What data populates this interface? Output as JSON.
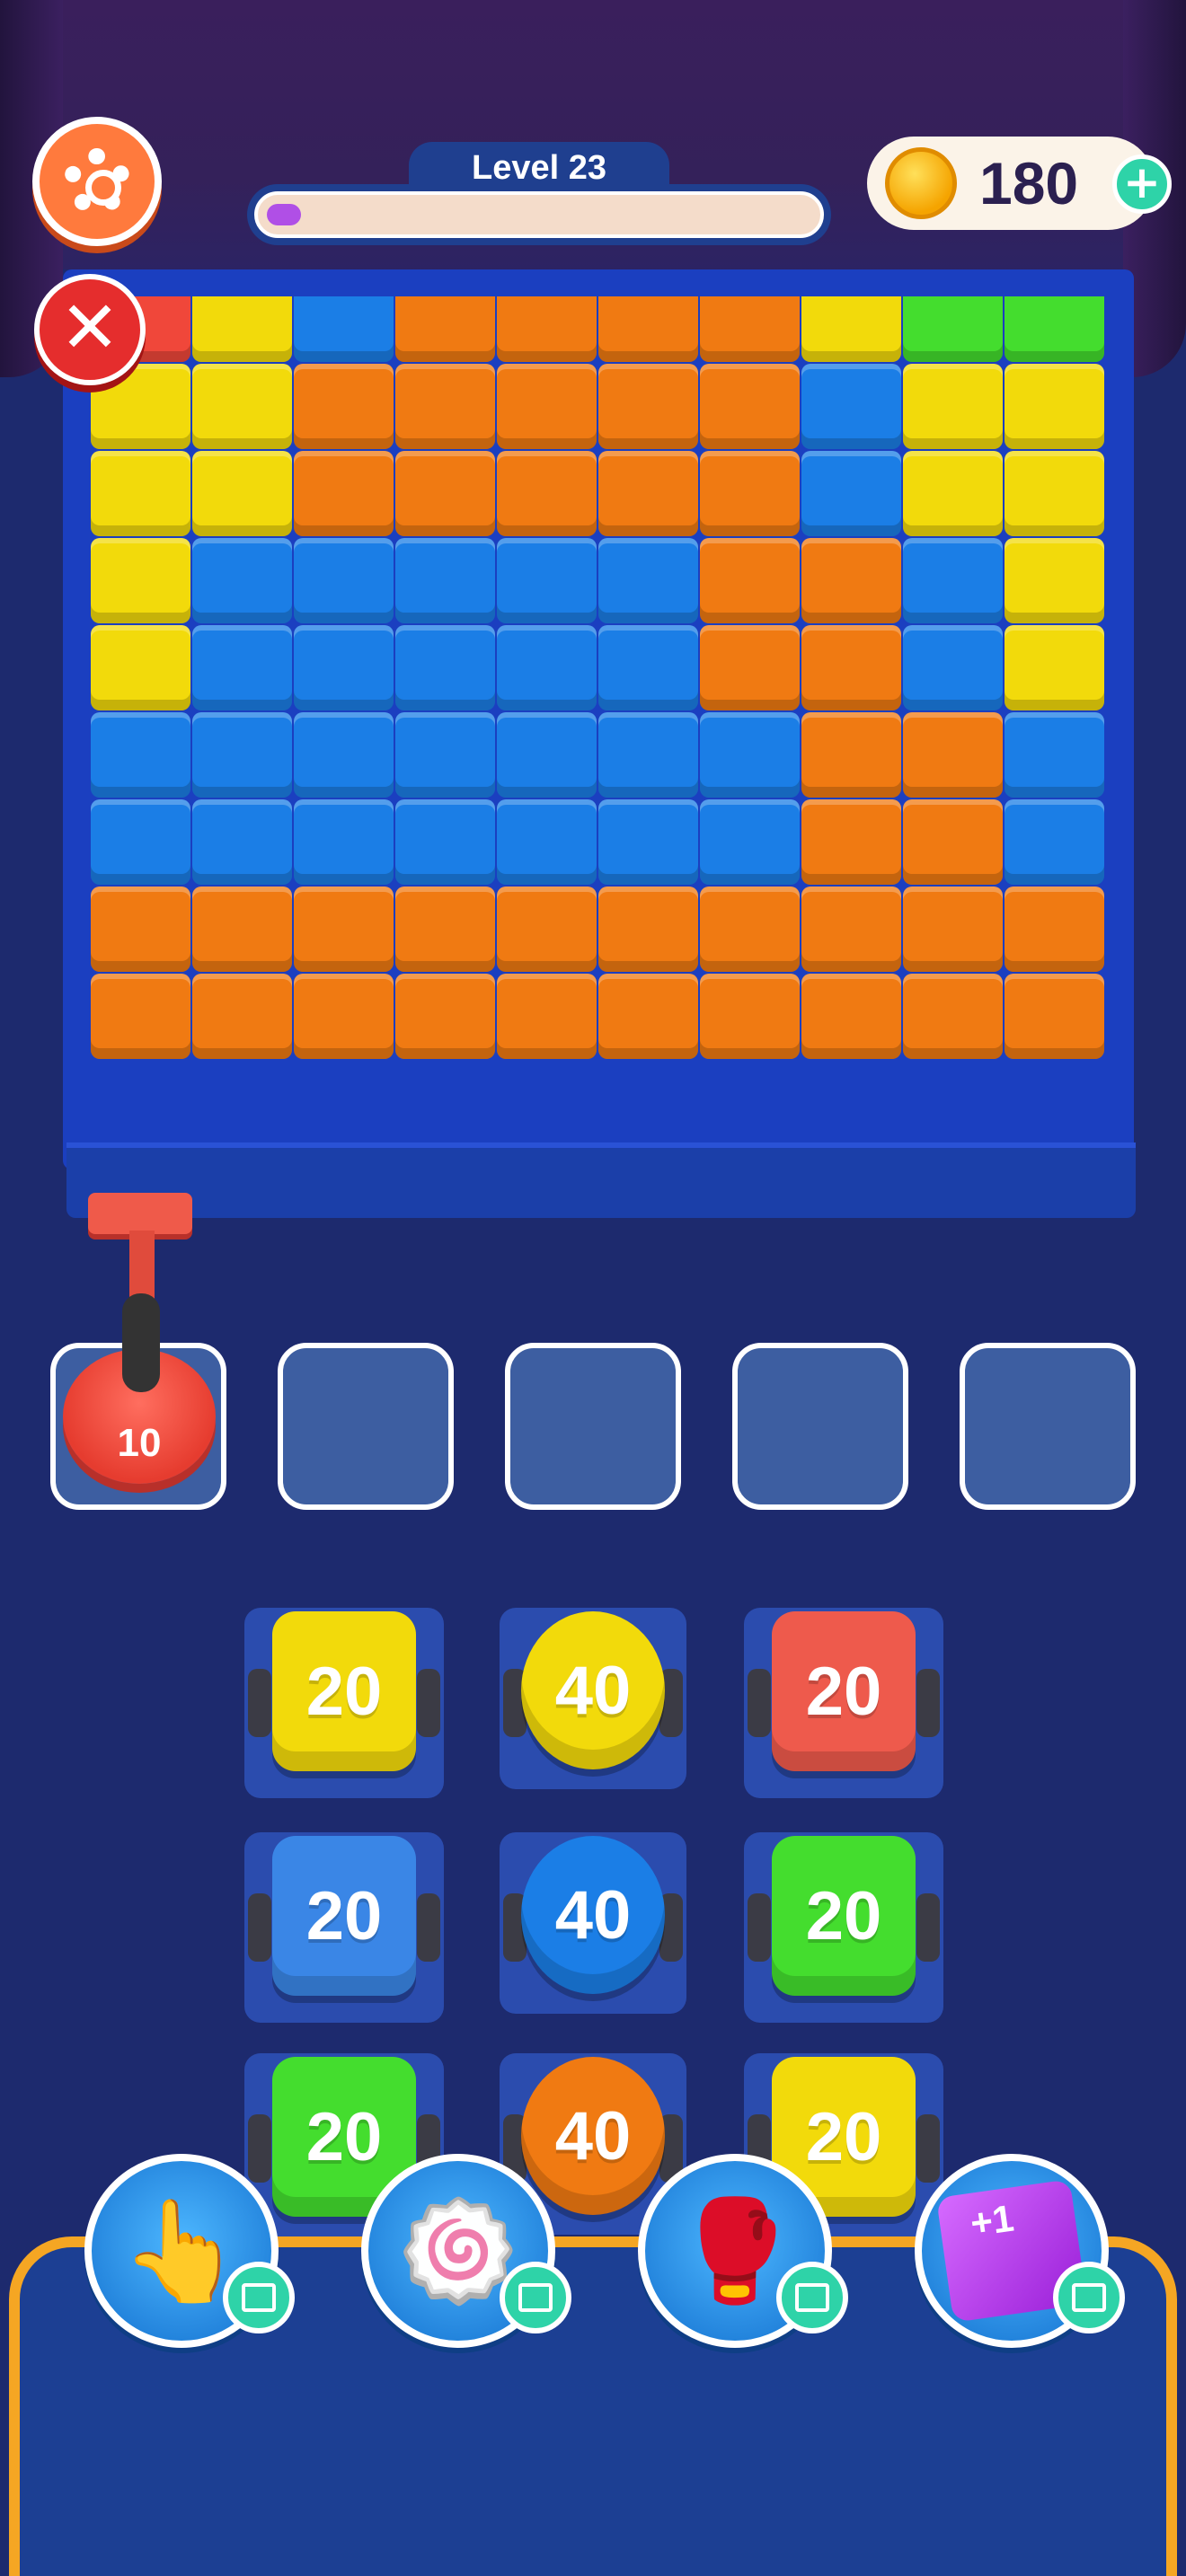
{
  "header": {
    "level_label": "Level 23",
    "level_progress": 0.05,
    "coins": "180",
    "add_coins_label": "+"
  },
  "board": {
    "columns": 10,
    "colors": {
      "R": "#f0473a",
      "Y": "#f2da0b",
      "B": "#1b7ee6",
      "O": "#f07a12",
      "G": "#44dd2e"
    },
    "rows": [
      [
        "R",
        "Y",
        "B",
        "O",
        "O",
        "O",
        "O",
        "Y",
        "G",
        "G"
      ],
      [
        "Y",
        "Y",
        "O",
        "O",
        "O",
        "O",
        "O",
        "B",
        "Y",
        "Y"
      ],
      [
        "Y",
        "Y",
        "O",
        "O",
        "O",
        "O",
        "O",
        "B",
        "Y",
        "Y"
      ],
      [
        "Y",
        "B",
        "B",
        "B",
        "B",
        "B",
        "O",
        "O",
        "B",
        "Y"
      ],
      [
        "Y",
        "B",
        "B",
        "B",
        "B",
        "B",
        "O",
        "O",
        "B",
        "Y"
      ],
      [
        "B",
        "B",
        "B",
        "B",
        "B",
        "B",
        "B",
        "O",
        "O",
        "B"
      ],
      [
        "B",
        "B",
        "B",
        "B",
        "B",
        "B",
        "B",
        "O",
        "O",
        "B"
      ],
      [
        "O",
        "O",
        "O",
        "O",
        "O",
        "O",
        "O",
        "O",
        "O",
        "O"
      ],
      [
        "O",
        "O",
        "O",
        "O",
        "O",
        "O",
        "O",
        "O",
        "O",
        "O"
      ]
    ]
  },
  "slots": {
    "count": 5,
    "active": {
      "value": "10",
      "color": "#e63c2f"
    }
  },
  "shooters": [
    {
      "value": "20",
      "color": "#f2da0b",
      "shape": "box"
    },
    {
      "value": "40",
      "color": "#f2da0b",
      "shape": "round"
    },
    {
      "value": "20",
      "color": "#ee5a4c",
      "shape": "box"
    },
    {
      "value": "20",
      "color": "#3a86e6",
      "shape": "box"
    },
    {
      "value": "40",
      "color": "#1b7ee6",
      "shape": "round"
    },
    {
      "value": "20",
      "color": "#44dd2e",
      "shape": "box"
    },
    {
      "value": "20",
      "color": "#44dd2e",
      "shape": "box"
    },
    {
      "value": "40",
      "color": "#f07a12",
      "shape": "round"
    },
    {
      "value": "20",
      "color": "#f2da0b",
      "shape": "box"
    }
  ],
  "boosters": [
    {
      "icon": "pointing-hand-icon",
      "glyph": "👆"
    },
    {
      "icon": "pinwheel-icon",
      "glyph": "🍥"
    },
    {
      "icon": "boxing-glove-icon",
      "glyph": "🥊"
    },
    {
      "icon": "cube-icon",
      "label": "+1"
    }
  ]
}
